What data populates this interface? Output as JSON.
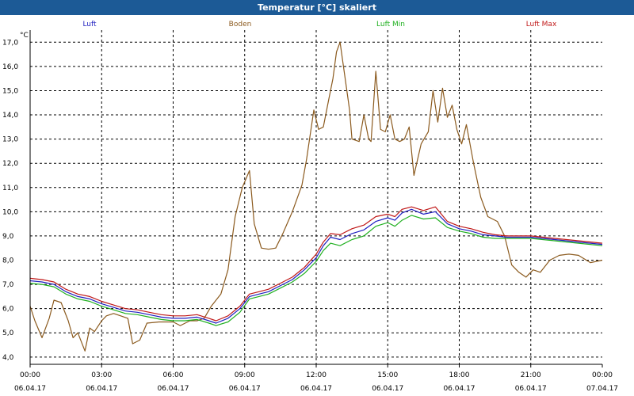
{
  "window": {
    "title": "Temperatur [°C] skaliert"
  },
  "chart_data": {
    "type": "line",
    "title": "Temperatur [°C] skaliert",
    "ylabel": "°C",
    "xlabel": "",
    "ylim": [
      3.7,
      17.5
    ],
    "xlim": [
      0,
      24
    ],
    "grid": true,
    "legend": "top",
    "y_ticks": [
      4.0,
      5.0,
      6.0,
      7.0,
      8.0,
      9.0,
      10.0,
      11.0,
      12.0,
      13.0,
      14.0,
      15.0,
      16.0,
      17.0
    ],
    "y_tick_labels": [
      "4,0",
      "5,0",
      "6,0",
      "7,0",
      "8,0",
      "9,0",
      "10,0",
      "11,0",
      "12,0",
      "13,0",
      "14,0",
      "15,0",
      "16,0",
      "17,0"
    ],
    "x_ticks": [
      {
        "hour": 0,
        "time": "00:00",
        "date": "06.04.17"
      },
      {
        "hour": 3,
        "time": "03:00",
        "date": "06.04.17"
      },
      {
        "hour": 6,
        "time": "06:00",
        "date": "06.04.17"
      },
      {
        "hour": 9,
        "time": "09:00",
        "date": "06.04.17"
      },
      {
        "hour": 12,
        "time": "12:00",
        "date": "06.04.17"
      },
      {
        "hour": 15,
        "time": "15:00",
        "date": "06.04.17"
      },
      {
        "hour": 18,
        "time": "18:00",
        "date": "06.04.17"
      },
      {
        "hour": 21,
        "time": "21:00",
        "date": "06.04.17"
      },
      {
        "hour": 24,
        "time": "00:00",
        "date": "07.04.17"
      }
    ],
    "series": [
      {
        "name": "Luft",
        "color": "#2020c0",
        "points": [
          [
            0,
            7.15
          ],
          [
            0.5,
            7.1
          ],
          [
            1,
            7.0
          ],
          [
            1.5,
            6.7
          ],
          [
            2,
            6.5
          ],
          [
            2.5,
            6.4
          ],
          [
            3,
            6.2
          ],
          [
            3.5,
            6.05
          ],
          [
            4,
            5.9
          ],
          [
            4.5,
            5.85
          ],
          [
            5,
            5.75
          ],
          [
            5.5,
            5.65
          ],
          [
            6,
            5.6
          ],
          [
            6.5,
            5.6
          ],
          [
            7,
            5.65
          ],
          [
            7.5,
            5.5
          ],
          [
            7.8,
            5.4
          ],
          [
            8.3,
            5.6
          ],
          [
            8.8,
            6.0
          ],
          [
            9.2,
            6.5
          ],
          [
            9.6,
            6.6
          ],
          [
            10,
            6.7
          ],
          [
            10.5,
            6.95
          ],
          [
            11,
            7.2
          ],
          [
            11.5,
            7.6
          ],
          [
            12,
            8.1
          ],
          [
            12.3,
            8.6
          ],
          [
            12.6,
            8.95
          ],
          [
            13,
            8.85
          ],
          [
            13.5,
            9.1
          ],
          [
            14,
            9.25
          ],
          [
            14.5,
            9.6
          ],
          [
            15,
            9.75
          ],
          [
            15.3,
            9.65
          ],
          [
            15.6,
            9.95
          ],
          [
            16,
            10.1
          ],
          [
            16.5,
            9.9
          ],
          [
            17,
            10.0
          ],
          [
            17.5,
            9.5
          ],
          [
            18,
            9.3
          ],
          [
            18.5,
            9.2
          ],
          [
            19,
            9.05
          ],
          [
            19.5,
            9.0
          ],
          [
            20,
            8.95
          ],
          [
            21,
            8.95
          ],
          [
            22,
            8.85
          ],
          [
            23,
            8.75
          ],
          [
            24,
            8.65
          ]
        ]
      },
      {
        "name": "Boden",
        "color": "#8b5a1e",
        "points": [
          [
            0,
            6.1
          ],
          [
            0.2,
            5.5
          ],
          [
            0.5,
            4.8
          ],
          [
            0.8,
            5.6
          ],
          [
            1,
            6.35
          ],
          [
            1.3,
            6.25
          ],
          [
            1.6,
            5.5
          ],
          [
            1.8,
            4.8
          ],
          [
            2,
            5.0
          ],
          [
            2.3,
            4.25
          ],
          [
            2.5,
            5.2
          ],
          [
            2.7,
            5.05
          ],
          [
            3,
            5.5
          ],
          [
            3.2,
            5.7
          ],
          [
            3.5,
            5.8
          ],
          [
            3.8,
            5.7
          ],
          [
            4.1,
            5.6
          ],
          [
            4.3,
            4.55
          ],
          [
            4.6,
            4.7
          ],
          [
            4.9,
            5.4
          ],
          [
            5.4,
            5.45
          ],
          [
            6,
            5.45
          ],
          [
            6.3,
            5.3
          ],
          [
            6.7,
            5.5
          ],
          [
            7,
            5.5
          ],
          [
            7.3,
            5.6
          ],
          [
            7.6,
            6.1
          ],
          [
            8.0,
            6.6
          ],
          [
            8.3,
            7.6
          ],
          [
            8.6,
            9.8
          ],
          [
            8.9,
            11.0
          ],
          [
            9.2,
            11.7
          ],
          [
            9.4,
            9.5
          ],
          [
            9.7,
            8.5
          ],
          [
            10.0,
            8.45
          ],
          [
            10.3,
            8.5
          ],
          [
            10.6,
            9.1
          ],
          [
            11.0,
            10.0
          ],
          [
            11.4,
            11.1
          ],
          [
            11.6,
            12.2
          ],
          [
            11.9,
            14.2
          ],
          [
            12.1,
            13.4
          ],
          [
            12.3,
            13.5
          ],
          [
            12.5,
            14.5
          ],
          [
            12.7,
            15.5
          ],
          [
            12.85,
            16.6
          ],
          [
            13.0,
            17.0
          ],
          [
            13.2,
            15.6
          ],
          [
            13.4,
            14.2
          ],
          [
            13.5,
            13.0
          ],
          [
            13.8,
            12.9
          ],
          [
            14.0,
            14.0
          ],
          [
            14.2,
            13.0
          ],
          [
            14.3,
            12.9
          ],
          [
            14.5,
            15.8
          ],
          [
            14.7,
            13.4
          ],
          [
            14.9,
            13.3
          ],
          [
            15.1,
            14.0
          ],
          [
            15.3,
            13.0
          ],
          [
            15.5,
            12.9
          ],
          [
            15.7,
            13.0
          ],
          [
            15.9,
            13.5
          ],
          [
            16.1,
            11.5
          ],
          [
            16.4,
            12.8
          ],
          [
            16.7,
            13.3
          ],
          [
            16.9,
            15.0
          ],
          [
            17.1,
            13.7
          ],
          [
            17.3,
            15.1
          ],
          [
            17.5,
            13.9
          ],
          [
            17.7,
            14.4
          ],
          [
            17.9,
            13.4
          ],
          [
            18.1,
            12.8
          ],
          [
            18.3,
            13.6
          ],
          [
            18.6,
            12.0
          ],
          [
            18.9,
            10.6
          ],
          [
            19.2,
            9.8
          ],
          [
            19.6,
            9.6
          ],
          [
            19.9,
            9.0
          ],
          [
            20.2,
            7.8
          ],
          [
            20.5,
            7.5
          ],
          [
            20.8,
            7.3
          ],
          [
            21.1,
            7.6
          ],
          [
            21.4,
            7.5
          ],
          [
            21.8,
            8.0
          ],
          [
            22.2,
            8.2
          ],
          [
            22.6,
            8.25
          ],
          [
            23,
            8.2
          ],
          [
            23.5,
            7.9
          ],
          [
            24,
            8.0
          ]
        ]
      },
      {
        "name": "Luft Min",
        "color": "#20b020",
        "points": [
          [
            0,
            7.05
          ],
          [
            0.5,
            7.0
          ],
          [
            1,
            6.9
          ],
          [
            1.5,
            6.6
          ],
          [
            2,
            6.4
          ],
          [
            2.5,
            6.3
          ],
          [
            3,
            6.1
          ],
          [
            3.5,
            5.95
          ],
          [
            4,
            5.8
          ],
          [
            4.5,
            5.75
          ],
          [
            5,
            5.65
          ],
          [
            5.5,
            5.55
          ],
          [
            6,
            5.5
          ],
          [
            6.5,
            5.5
          ],
          [
            7,
            5.55
          ],
          [
            7.5,
            5.4
          ],
          [
            7.8,
            5.3
          ],
          [
            8.3,
            5.45
          ],
          [
            8.8,
            5.85
          ],
          [
            9.2,
            6.4
          ],
          [
            9.6,
            6.5
          ],
          [
            10,
            6.6
          ],
          [
            10.5,
            6.85
          ],
          [
            11,
            7.1
          ],
          [
            11.5,
            7.45
          ],
          [
            12,
            7.95
          ],
          [
            12.3,
            8.4
          ],
          [
            12.6,
            8.7
          ],
          [
            13,
            8.6
          ],
          [
            13.5,
            8.85
          ],
          [
            14,
            9.0
          ],
          [
            14.5,
            9.4
          ],
          [
            15,
            9.55
          ],
          [
            15.3,
            9.4
          ],
          [
            15.6,
            9.65
          ],
          [
            16,
            9.85
          ],
          [
            16.5,
            9.7
          ],
          [
            17,
            9.75
          ],
          [
            17.5,
            9.35
          ],
          [
            18,
            9.2
          ],
          [
            18.5,
            9.1
          ],
          [
            19,
            8.95
          ],
          [
            19.5,
            8.9
          ],
          [
            20,
            8.9
          ],
          [
            21,
            8.9
          ],
          [
            22,
            8.8
          ],
          [
            23,
            8.7
          ],
          [
            24,
            8.6
          ]
        ]
      },
      {
        "name": "Luft Max",
        "color": "#c01818",
        "points": [
          [
            0,
            7.25
          ],
          [
            0.5,
            7.2
          ],
          [
            1,
            7.1
          ],
          [
            1.5,
            6.8
          ],
          [
            2,
            6.6
          ],
          [
            2.5,
            6.5
          ],
          [
            3,
            6.3
          ],
          [
            3.5,
            6.15
          ],
          [
            4,
            6.0
          ],
          [
            4.5,
            5.95
          ],
          [
            5,
            5.85
          ],
          [
            5.5,
            5.75
          ],
          [
            6,
            5.7
          ],
          [
            6.5,
            5.7
          ],
          [
            7,
            5.75
          ],
          [
            7.5,
            5.6
          ],
          [
            7.8,
            5.5
          ],
          [
            8.3,
            5.7
          ],
          [
            8.8,
            6.1
          ],
          [
            9.2,
            6.6
          ],
          [
            9.6,
            6.7
          ],
          [
            10,
            6.8
          ],
          [
            10.5,
            7.05
          ],
          [
            11,
            7.3
          ],
          [
            11.5,
            7.7
          ],
          [
            12,
            8.25
          ],
          [
            12.3,
            8.75
          ],
          [
            12.6,
            9.1
          ],
          [
            13,
            9.05
          ],
          [
            13.5,
            9.3
          ],
          [
            14,
            9.45
          ],
          [
            14.5,
            9.8
          ],
          [
            15,
            9.9
          ],
          [
            15.3,
            9.8
          ],
          [
            15.6,
            10.1
          ],
          [
            16,
            10.2
          ],
          [
            16.5,
            10.05
          ],
          [
            17,
            10.2
          ],
          [
            17.5,
            9.6
          ],
          [
            18,
            9.4
          ],
          [
            18.5,
            9.3
          ],
          [
            19,
            9.15
          ],
          [
            19.5,
            9.05
          ],
          [
            20,
            9.0
          ],
          [
            21,
            9.0
          ],
          [
            22,
            8.9
          ],
          [
            23,
            8.8
          ],
          [
            24,
            8.7
          ]
        ]
      }
    ]
  }
}
